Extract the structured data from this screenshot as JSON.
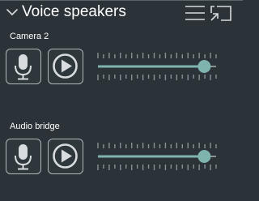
{
  "header": {
    "title": "Voice speakers",
    "collapse_icon": "chevron-down-icon",
    "menu_icon": "hamburger-menu-icon",
    "cast_icon": "cast-screen-icon"
  },
  "channels": [
    {
      "label": "Camera 2",
      "mic_icon": "microphone-icon",
      "play_icon": "play-icon",
      "volume": 0.9
    },
    {
      "label": "Audio bridge",
      "mic_icon": "microphone-icon",
      "play_icon": "play-icon",
      "volume": 0.9
    }
  ],
  "colors": {
    "background": "#2b3338",
    "slider_fill": "#7fb3ad",
    "slider_track": "#8a9296",
    "tick": "#8a9296",
    "button_border": "#b0b8bc",
    "icon": "#d8dcde"
  }
}
